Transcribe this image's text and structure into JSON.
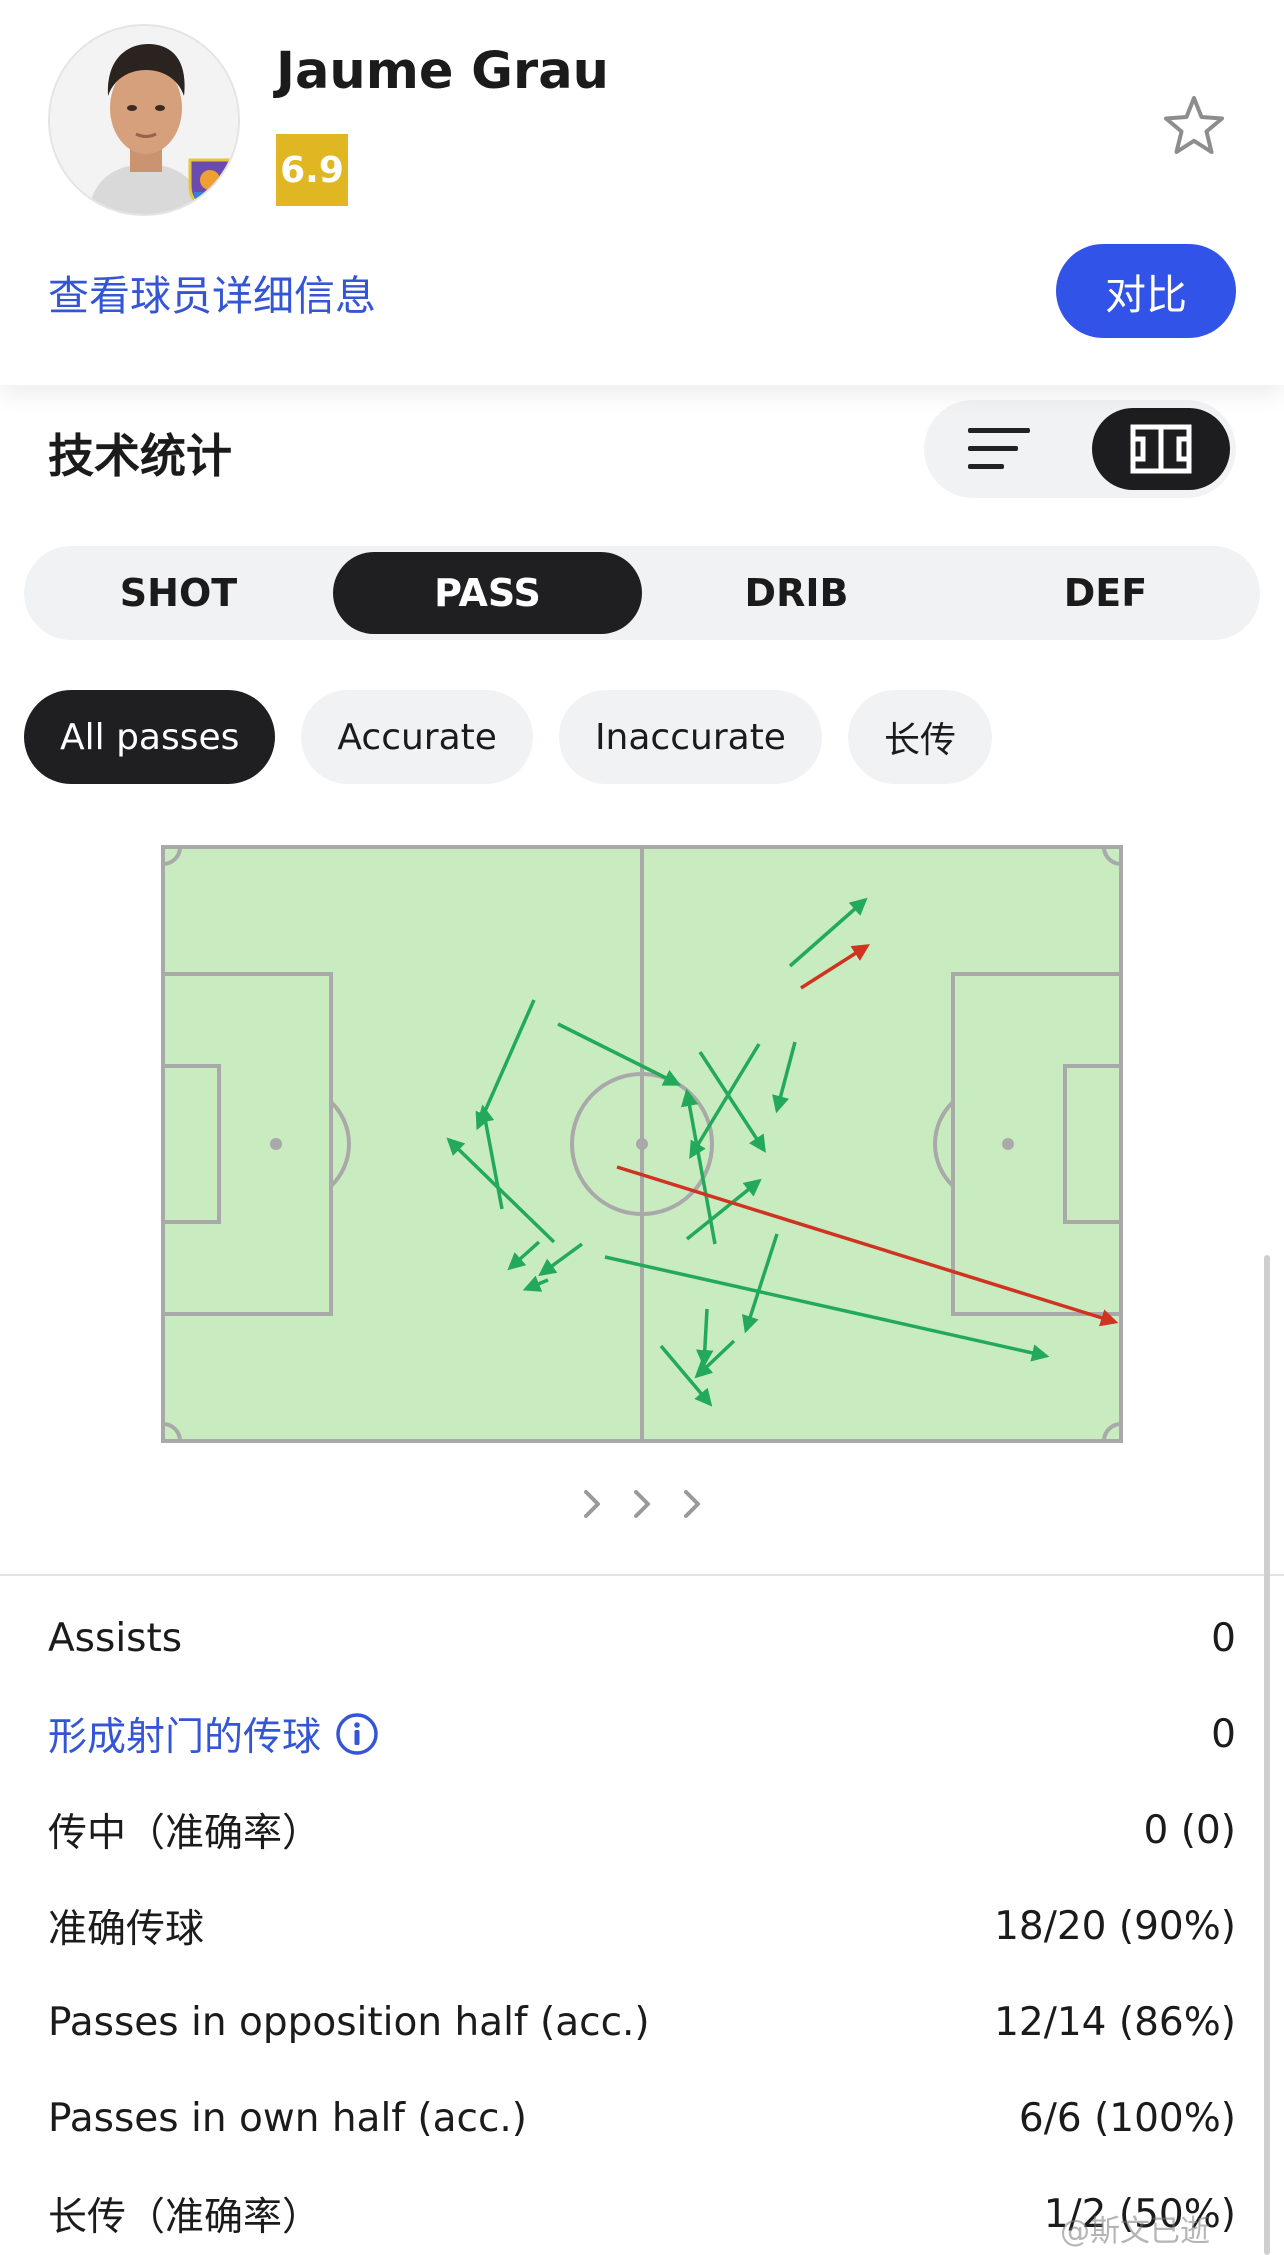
{
  "header": {
    "player_name": "Jaume Grau",
    "rating": "6.9",
    "detail_link": "查看球员详细信息",
    "compare_button": "对比",
    "rating_color": "#e0b623",
    "accent_color": "#3253e8"
  },
  "section": {
    "title": "技术统计",
    "view_options": [
      "list-icon",
      "pitch-icon"
    ],
    "active_view": "pitch-icon"
  },
  "tabs": [
    {
      "label": "SHOT",
      "active": false
    },
    {
      "label": "PASS",
      "active": true
    },
    {
      "label": "DRIB",
      "active": false
    },
    {
      "label": "DEF",
      "active": false
    }
  ],
  "filters": [
    {
      "label": "All passes",
      "active": true
    },
    {
      "label": "Accurate",
      "active": false
    },
    {
      "label": "Inaccurate",
      "active": false
    },
    {
      "label": "长传",
      "active": false
    }
  ],
  "pitch": {
    "accurate_color": "#22a95a",
    "inaccurate_color": "#d0331f",
    "field_color": "#c8ebc0"
  },
  "stats": [
    {
      "label": "Assists",
      "value": "0",
      "link": false
    },
    {
      "label": "形成射门的传球",
      "value": "0",
      "link": true
    },
    {
      "label": "传中（准确率）",
      "value": "0 (0)",
      "link": false
    },
    {
      "label": "准确传球",
      "value": "18/20 (90%)",
      "link": false
    },
    {
      "label": "Passes in opposition half (acc.)",
      "value": "12/14 (86%)",
      "link": false
    },
    {
      "label": "Passes in own half (acc.)",
      "value": "6/6 (100%)",
      "link": false
    },
    {
      "label": "长传（准确率）",
      "value": "1/2 (50%)",
      "link": false
    }
  ],
  "watermark": "@斯文已逝"
}
